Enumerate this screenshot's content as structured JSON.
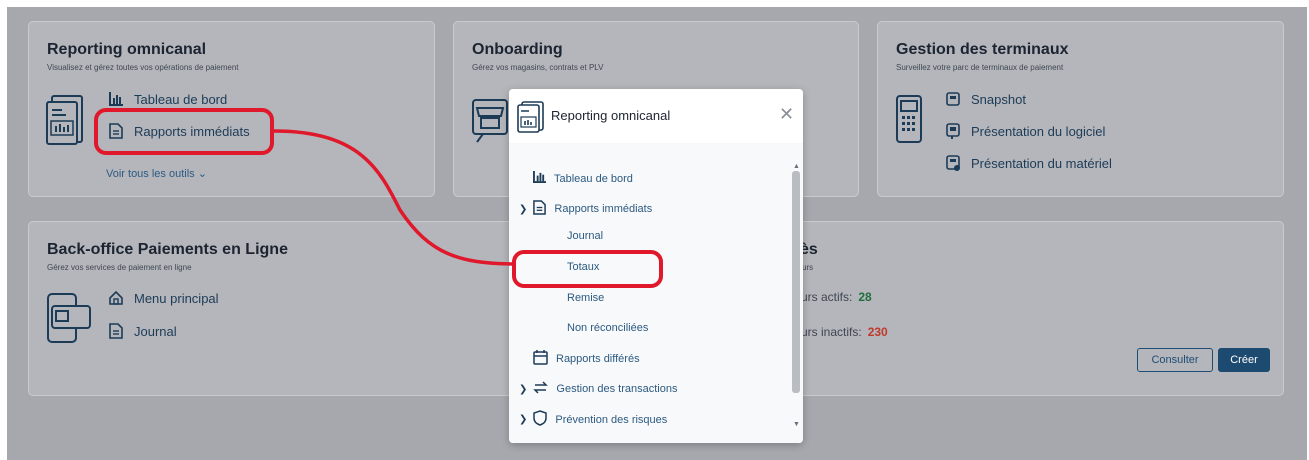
{
  "cards": {
    "reporting": {
      "title": "Reporting omnicanal",
      "subtitle": "Visualisez et gérez toutes vos opérations de paiement",
      "items": [
        "Tableau de bord",
        "Rapports immédiats"
      ],
      "more_link": "Voir tous les outils"
    },
    "onboarding": {
      "title": "Onboarding",
      "subtitle": "Gérez vos magasins, contrats et PLV"
    },
    "terminaux": {
      "title": "Gestion des terminaux",
      "subtitle": "Surveillez votre parc de terminaux de paiement",
      "items": [
        "Snapshot",
        "Présentation du logiciel",
        "Présentation du matériel"
      ]
    },
    "backoffice": {
      "title": "Back-office Paiements en Ligne",
      "subtitle": "Gérez vos services de paiement en ligne",
      "items": [
        "Menu principal",
        "Journal"
      ]
    },
    "partial": {
      "title_fragment": "ès",
      "subtitle_fragment": "urs",
      "active_label": "urs actifs:",
      "active_value": "28",
      "inactive_label": "urs inactifs:",
      "inactive_value": "230",
      "consult_button": "Consulter",
      "create_button": "Créer"
    }
  },
  "modal": {
    "title": "Reporting omnicanal",
    "items": {
      "dashboard": "Tableau de bord",
      "immediate": "Rapports immédiats",
      "journal": "Journal",
      "totaux": "Totaux",
      "remise": "Remise",
      "non_reconciliees": "Non réconciliées",
      "deferred": "Rapports différés",
      "transactions": "Gestion des transactions",
      "risks": "Prévention des risques"
    }
  },
  "colors": {
    "overlay": "#a6a8ae",
    "annotation": "#e0182b",
    "link": "#2c5a82",
    "active_count": "#1f6e3d",
    "inactive_count": "#c0392b"
  },
  "icons": [
    "bar-chart-icon",
    "document-icon",
    "chevron-down-icon",
    "chevron-right-icon",
    "calendar-icon",
    "transfer-icon",
    "shield-icon",
    "close-icon",
    "home-icon",
    "terminal-icon",
    "cash-register-icon",
    "card-reader-icon"
  ]
}
